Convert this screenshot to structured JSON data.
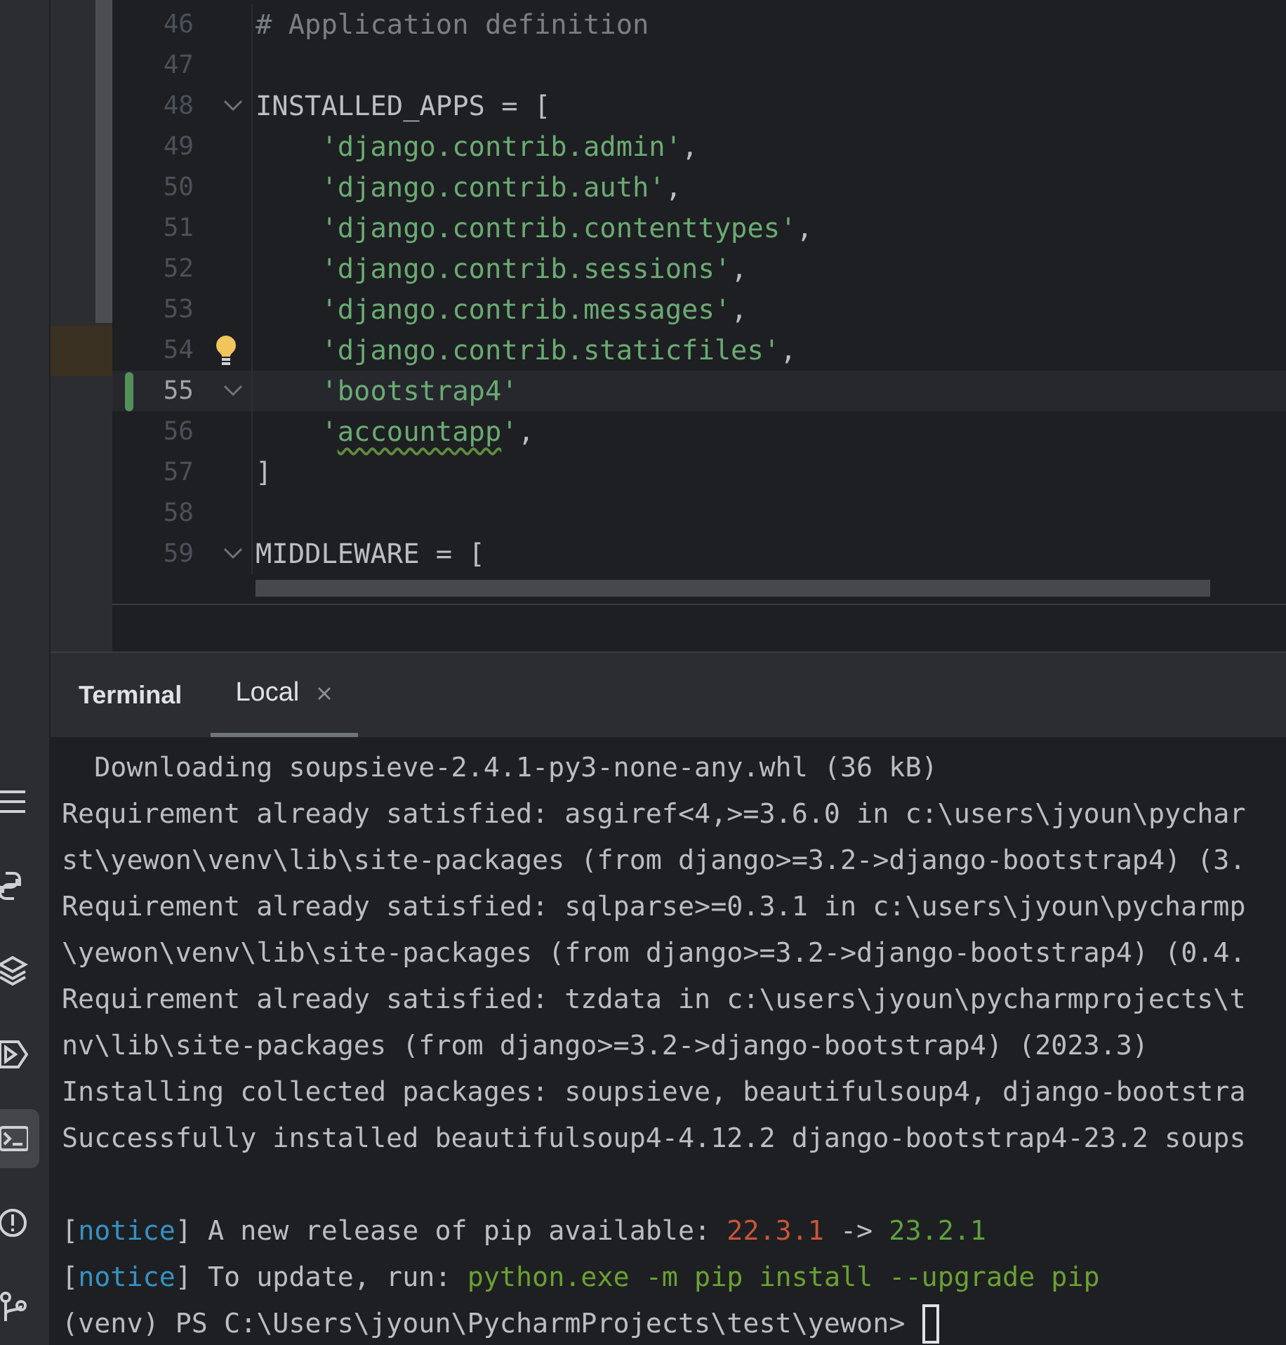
{
  "editor": {
    "lines": [
      {
        "number": "46",
        "fold": false,
        "hint": false,
        "current": false,
        "changed": false,
        "parts": [
          {
            "text": "# Application definition",
            "kind": "comment"
          }
        ]
      },
      {
        "number": "47",
        "fold": false,
        "hint": false,
        "current": false,
        "changed": false
      },
      {
        "number": "48",
        "fold": true,
        "hint": false,
        "current": false,
        "changed": false,
        "parts": [
          {
            "text": "INSTALLED_APPS = [",
            "kind": "plain"
          }
        ]
      },
      {
        "number": "49",
        "fold": false,
        "hint": false,
        "current": false,
        "changed": false,
        "parts": [
          {
            "text": "    'django.contrib.admin'",
            "kind": "string"
          },
          {
            "text": ",",
            "kind": "plain"
          }
        ]
      },
      {
        "number": "50",
        "fold": false,
        "hint": false,
        "current": false,
        "changed": false,
        "parts": [
          {
            "text": "    'django.contrib.auth'",
            "kind": "string"
          },
          {
            "text": ",",
            "kind": "plain"
          }
        ]
      },
      {
        "number": "51",
        "fold": false,
        "hint": false,
        "current": false,
        "changed": false,
        "parts": [
          {
            "text": "    'django.contrib.contenttypes'",
            "kind": "string"
          },
          {
            "text": ",",
            "kind": "plain"
          }
        ]
      },
      {
        "number": "52",
        "fold": false,
        "hint": false,
        "current": false,
        "changed": false,
        "parts": [
          {
            "text": "    'django.contrib.sessions'",
            "kind": "string"
          },
          {
            "text": ",",
            "kind": "plain"
          }
        ]
      },
      {
        "number": "53",
        "fold": false,
        "hint": false,
        "current": false,
        "changed": false,
        "parts": [
          {
            "text": "    'django.contrib.messages'",
            "kind": "string"
          },
          {
            "text": ",",
            "kind": "plain"
          }
        ]
      },
      {
        "number": "54",
        "fold": false,
        "hint": true,
        "current": false,
        "changed": false,
        "parts": [
          {
            "text": "    'django.contrib.staticfiles'",
            "kind": "string"
          },
          {
            "text": ",",
            "kind": "plain"
          }
        ]
      },
      {
        "number": "55",
        "fold": true,
        "hint": false,
        "current": true,
        "changed": true,
        "parts": [
          {
            "text": "    'bootstrap4'",
            "kind": "string"
          }
        ]
      },
      {
        "number": "56",
        "fold": false,
        "hint": false,
        "current": false,
        "changed": false,
        "parts": [
          {
            "text": "    '",
            "kind": "string"
          },
          {
            "text": "accountapp",
            "kind": "typo"
          },
          {
            "text": "'",
            "kind": "string"
          },
          {
            "text": ",",
            "kind": "plain"
          }
        ]
      },
      {
        "number": "57",
        "fold": false,
        "hint": false,
        "current": false,
        "changed": false,
        "parts": [
          {
            "text": "]",
            "kind": "plain"
          }
        ]
      },
      {
        "number": "58",
        "fold": false,
        "hint": false,
        "current": false,
        "changed": false
      },
      {
        "number": "59",
        "fold": true,
        "hint": false,
        "current": false,
        "changed": false,
        "parts": [
          {
            "text": "MIDDLEWARE = [",
            "kind": "plain"
          }
        ]
      }
    ]
  },
  "terminal": {
    "title": "Terminal",
    "tabs": [
      {
        "label": "Local",
        "selected": true,
        "closable": true
      }
    ],
    "lines": [
      {
        "kind": "output",
        "parts": [
          {
            "text": "  Downloading soupsieve-2.4.1-py3-none-any.whl (36 kB)",
            "kind": "plain"
          }
        ]
      },
      {
        "kind": "output",
        "parts": [
          {
            "text": "Requirement already satisfied: asgiref<4,>=3.6.0 in c:\\users\\jyoun\\pychar",
            "kind": "plain"
          }
        ]
      },
      {
        "kind": "output",
        "parts": [
          {
            "text": "st\\yewon\\venv\\lib\\site-packages (from django>=3.2->django-bootstrap4) (3.",
            "kind": "plain"
          }
        ]
      },
      {
        "kind": "output",
        "parts": [
          {
            "text": "Requirement already satisfied: sqlparse>=0.3.1 in c:\\users\\jyoun\\pycharmp",
            "kind": "plain"
          }
        ]
      },
      {
        "kind": "output",
        "parts": [
          {
            "text": "\\yewon\\venv\\lib\\site-packages (from django>=3.2->django-bootstrap4) (0.4.",
            "kind": "plain"
          }
        ]
      },
      {
        "kind": "output",
        "parts": [
          {
            "text": "Requirement already satisfied: tzdata in c:\\users\\jyoun\\pycharmprojects\\t",
            "kind": "plain"
          }
        ]
      },
      {
        "kind": "output",
        "parts": [
          {
            "text": "nv\\lib\\site-packages (from django>=3.2->django-bootstrap4) (2023.3)",
            "kind": "plain"
          }
        ]
      },
      {
        "kind": "output",
        "parts": [
          {
            "text": "Installing collected packages: soupsieve, beautifulsoup4, django-bootstra",
            "kind": "plain"
          }
        ]
      },
      {
        "kind": "output",
        "parts": [
          {
            "text": "Successfully installed beautifulsoup4-4.12.2 django-bootstrap4-23.2 soups",
            "kind": "plain"
          }
        ]
      },
      {
        "kind": "blank"
      },
      {
        "kind": "output",
        "parts": [
          {
            "text": "[",
            "kind": "plain"
          },
          {
            "text": "notice",
            "kind": "notice"
          },
          {
            "text": "] A new release of pip available: ",
            "kind": "plain"
          },
          {
            "text": "22.3.1",
            "kind": "old"
          },
          {
            "text": " -> ",
            "kind": "plain"
          },
          {
            "text": "23.2.1",
            "kind": "new"
          }
        ]
      },
      {
        "kind": "output",
        "parts": [
          {
            "text": "[",
            "kind": "plain"
          },
          {
            "text": "notice",
            "kind": "notice"
          },
          {
            "text": "] To update, run: ",
            "kind": "plain"
          },
          {
            "text": "python.exe -m pip install --upgrade pip",
            "kind": "command"
          }
        ]
      },
      {
        "kind": "prompt",
        "parts": [
          {
            "text": "(venv) PS C:\\Users\\jyoun\\PycharmProjects\\test\\yewon>",
            "kind": "plain"
          }
        ]
      }
    ]
  },
  "toolbar": {
    "items": [
      {
        "kind": "menu",
        "selected": false
      },
      {
        "kind": "python",
        "selected": false
      },
      {
        "kind": "layers",
        "selected": false
      },
      {
        "kind": "run",
        "selected": false
      },
      {
        "kind": "terminal",
        "selected": true
      },
      {
        "kind": "problems",
        "selected": false
      },
      {
        "kind": "git",
        "selected": false
      }
    ]
  }
}
